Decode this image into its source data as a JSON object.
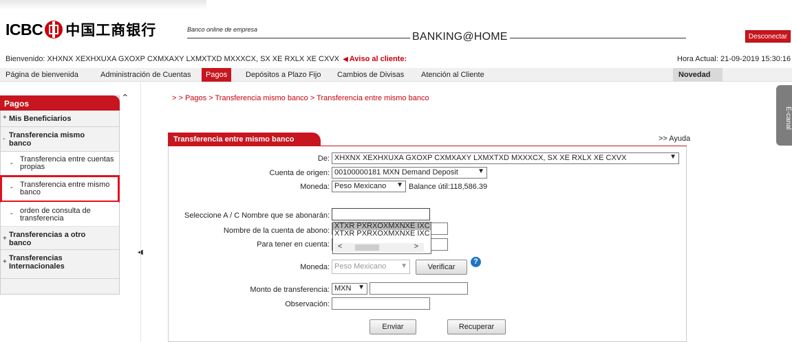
{
  "header": {
    "logo_text": "ICBC",
    "logo_cn": "中国工商银行",
    "tagline": "Banco online de empresa",
    "product": "BANKING@HOME",
    "logout_label": "Desconectar"
  },
  "welcome": {
    "text": "Bienvenido: XHXNX XEXHXUXA GXOXP CXMXAXY LXMXTXD MXXXCX, SX XE RXLX XE CXVX",
    "aviso": "Aviso al cliente:",
    "hora": "Hora Actual: 21-09-2019 15:30:16"
  },
  "nav": {
    "items": [
      "Página de bienvenida",
      "Administración de Cuentas",
      "Pagos",
      "Depósitos a Plazo Fijo",
      "Cambios de Divisas",
      "Atención al Cliente"
    ],
    "novedad": "Novedad"
  },
  "sidebar": {
    "title": "Pagos",
    "sections": [
      {
        "label": "Mis Beneficiarios",
        "marker": "+"
      },
      {
        "label": "Transferencia mismo banco",
        "marker": "-"
      }
    ],
    "subitems": [
      "Transferencia entre cuentas propias",
      "Transferencia entre mismo banco",
      "orden de consulta de transferencia"
    ],
    "more_sections": [
      {
        "label": "Transferencias a otro banco",
        "marker": "+"
      },
      {
        "label": "Transferencias Internacionales",
        "marker": "+"
      }
    ]
  },
  "breadcrumb": "> > Pagos > Transferencia mismo banco > Transferencia entre mismo banco",
  "ecanal": "E-canal",
  "form": {
    "title": "Transferencia entre mismo banco",
    "ayuda": ">> Ayuda",
    "de_label": "De:",
    "de_value": "XHXNX XEXHXUXA GXOXP CXMXAXY LXMXTXD MXXXCX, SX XE RXLX XE CXVX",
    "cuenta_origen_label": "Cuenta de origen:",
    "cuenta_origen_value": "00100000181 MXN Demand Deposit",
    "moneda_label": "Moneda:",
    "moneda_value": "Peso Mexicano",
    "balance": "Balance útil:118,586.39",
    "seleccione_label": "Seleccione A / C Nombre que se abonarán:",
    "nombre_cuenta_label": "Nombre de la cuenta de abono:",
    "para_tener_label": "Para tener en cuenta:",
    "autocomplete_options": [
      "XTXR PXRXOXMXNXE IXC",
      "XTXR PXRXOXMXNXE IXC"
    ],
    "moneda2_label": "Moneda:",
    "moneda2_value": "Peso Mexicano",
    "verificar": "Verificar",
    "monto_label": "Monto de transferencia:",
    "monto_currency": "MXN",
    "observacion_label": "Observación:",
    "enviar": "Enviar",
    "recuperar": "Recuperar"
  }
}
